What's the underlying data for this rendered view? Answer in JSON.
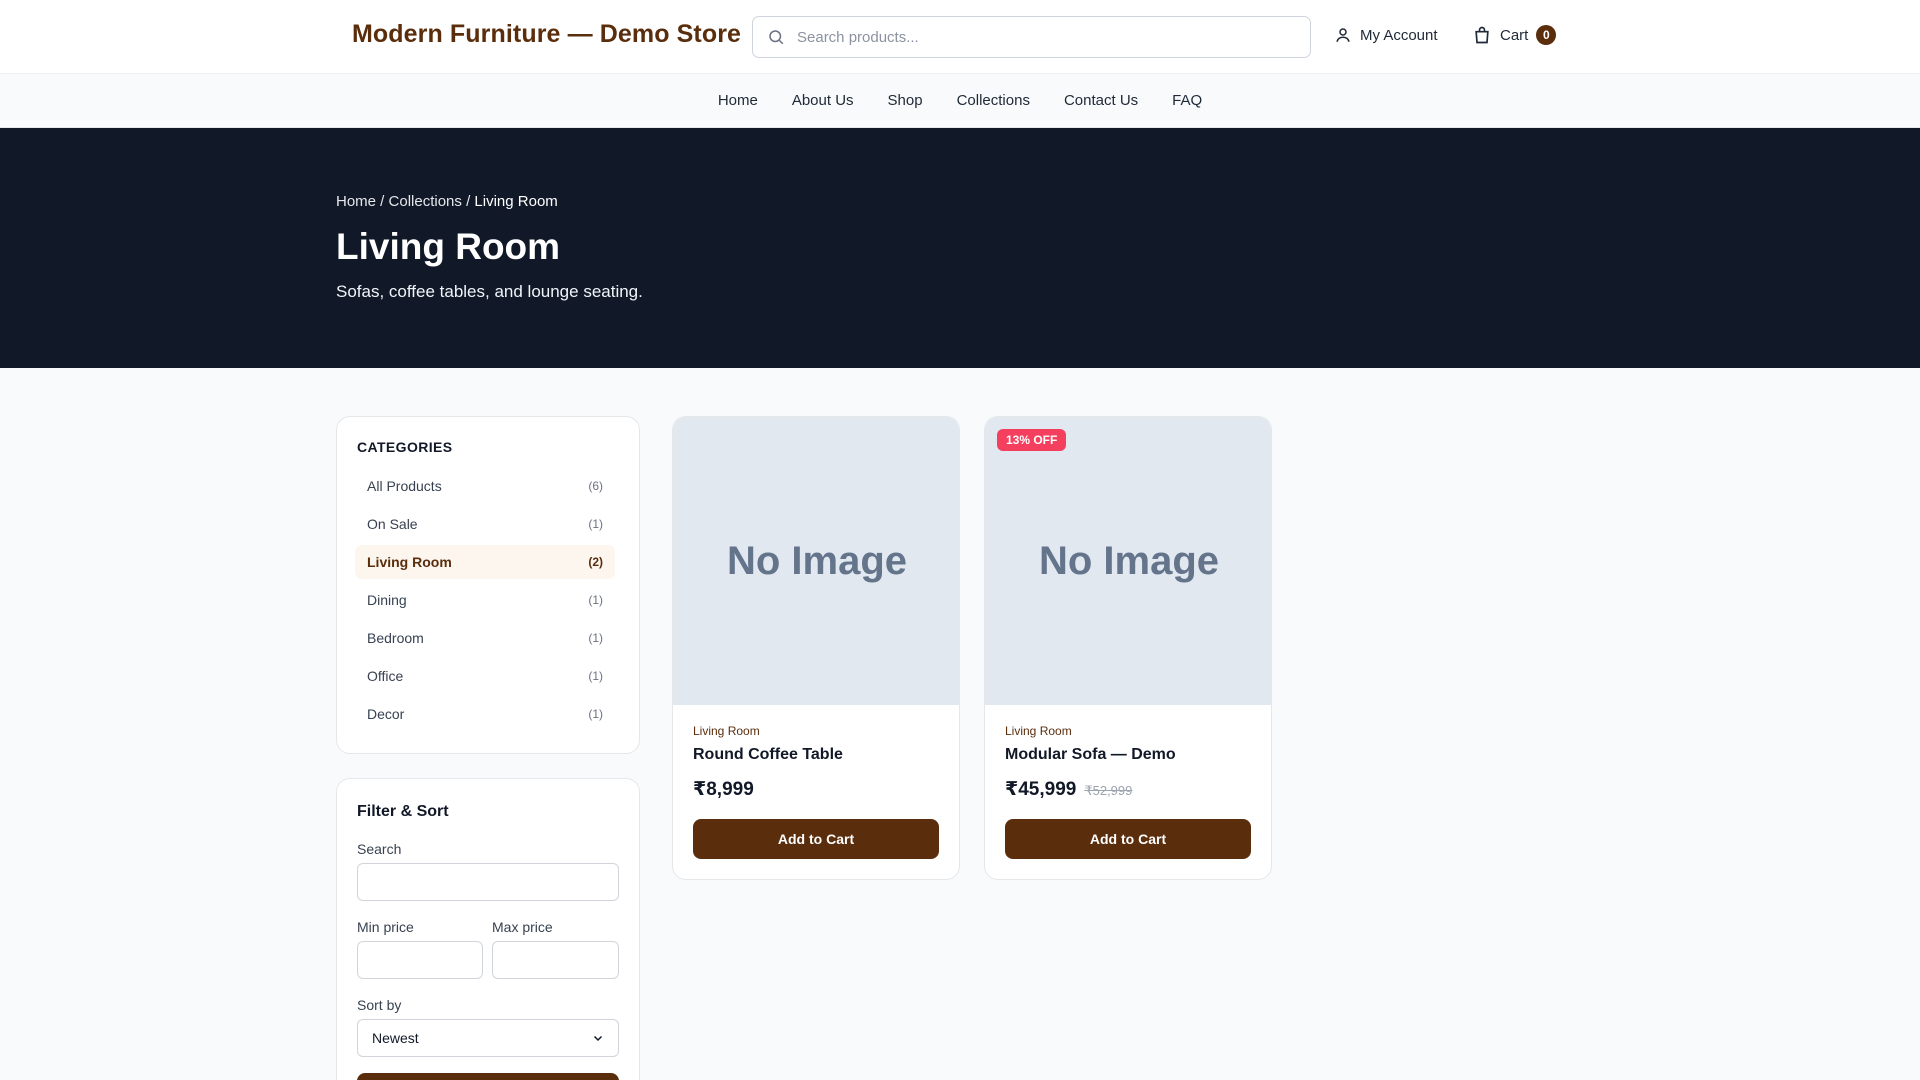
{
  "header": {
    "logo": "Modern Furniture — Demo Store",
    "search_placeholder": "Search products...",
    "account_label": "My Account",
    "cart_label": "Cart",
    "cart_count": "0"
  },
  "nav": {
    "items": [
      {
        "label": "Home"
      },
      {
        "label": "About Us"
      },
      {
        "label": "Shop"
      },
      {
        "label": "Collections"
      },
      {
        "label": "Contact Us"
      },
      {
        "label": "FAQ"
      }
    ]
  },
  "hero": {
    "breadcrumb": {
      "home": "Home",
      "sep": " / ",
      "collections": "Collections",
      "current": "Living Room"
    },
    "title": "Living Room",
    "subtitle": "Sofas, coffee tables, and lounge seating."
  },
  "categories": {
    "heading": "CATEGORIES",
    "items": [
      {
        "label": "All Products",
        "count": "(6)"
      },
      {
        "label": "On Sale",
        "count": "(1)"
      },
      {
        "label": "Living Room",
        "count": "(2)",
        "active": true
      },
      {
        "label": "Dining",
        "count": "(1)"
      },
      {
        "label": "Bedroom",
        "count": "(1)"
      },
      {
        "label": "Office",
        "count": "(1)"
      },
      {
        "label": "Decor",
        "count": "(1)"
      }
    ]
  },
  "filters": {
    "heading": "Filter & Sort",
    "search_label": "Search",
    "search_value": "",
    "min_price_label": "Min price",
    "min_price_value": "",
    "max_price_label": "Max price",
    "max_price_value": "",
    "sort_label": "Sort by",
    "sort_value": "Newest"
  },
  "products": [
    {
      "image_text": "No Image",
      "category": "Living Room",
      "name": "Round Coffee Table",
      "price": "₹8,999",
      "add_label": "Add to Cart"
    },
    {
      "image_text": "No Image",
      "badge": "13% OFF",
      "category": "Living Room",
      "name": "Modular Sofa — Demo",
      "price": "₹45,999",
      "old_price": "₹52,999",
      "add_label": "Add to Cart"
    }
  ],
  "colors": {
    "brand": "#5a2d0c",
    "hero_bg": "#111827",
    "sale_badge": "#f43f5e",
    "placeholder_bg": "#e2e8f0"
  }
}
